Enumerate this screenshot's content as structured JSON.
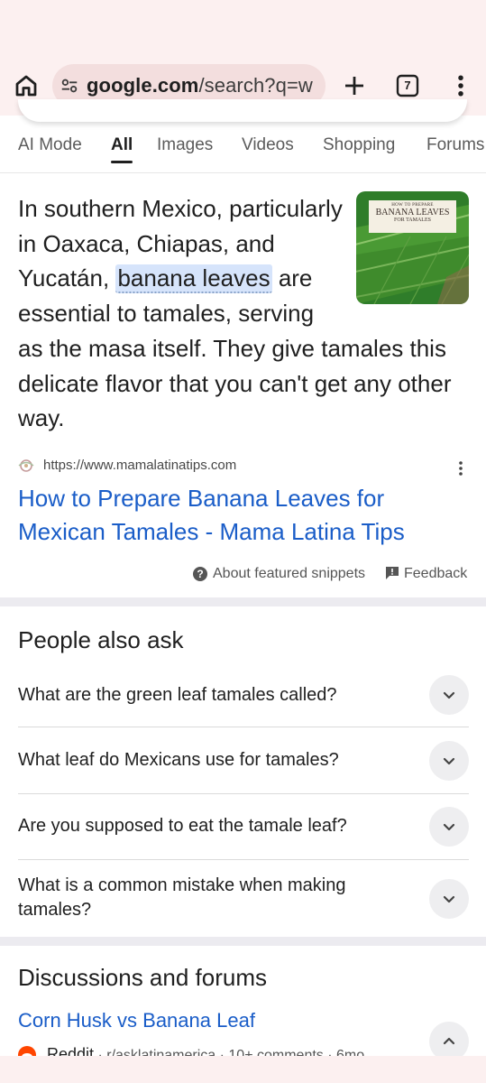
{
  "browser": {
    "url_bold": "google.com",
    "url_rest": "/search?q=w",
    "tab_count": "7"
  },
  "nav_tabs": [
    "AI Mode",
    "All",
    "Images",
    "Videos",
    "Shopping",
    "Forums"
  ],
  "snippet": {
    "text_before": "In southern Mexico, particularly in Oaxaca, Chiapas, and Yucatán,",
    "highlight": "banana leaves",
    "text_after": "are essential to tamales, serving as the masa itself. They give tamales this delicate flavor that you can't get any other way.",
    "thumbnail": {
      "small": "HOW TO PREPARE",
      "big": "BANANA LEAVES",
      "sub": "FOR TAMALES"
    },
    "source_url": "https://www.mamalatinatips.com",
    "result_title": "How to Prepare Banana Leaves for Mexican Tamales - Mama Latina Tips",
    "about_label": "About featured snippets",
    "feedback_label": "Feedback"
  },
  "people_also_ask": {
    "title": "People also ask",
    "questions": [
      "What are the green leaf tamales called?",
      "What leaf do Mexicans use for tamales?",
      "Are you supposed to eat the tamale leaf?",
      "What is a common mistake when making tamales?"
    ]
  },
  "discussions": {
    "title": "Discussions and forums",
    "link": "Corn Husk vs Banana Leaf",
    "site": "Reddit",
    "meta": " · r/asklatinamerica · 10+ comments · 6mo"
  },
  "colors": {
    "chrome_bg": "#fcf0f0",
    "url_pill": "#f3dede",
    "link_blue": "#1a5dc8",
    "highlight": "#d6e4fb",
    "divider": "#ecebf0"
  },
  "icons": [
    "home-icon",
    "tune-icon",
    "plus-icon",
    "tabs-icon",
    "more-vert-icon",
    "favicon-icon",
    "help-icon",
    "feedback-icon",
    "chevron-down-icon",
    "chevron-up-icon",
    "reddit-icon"
  ]
}
